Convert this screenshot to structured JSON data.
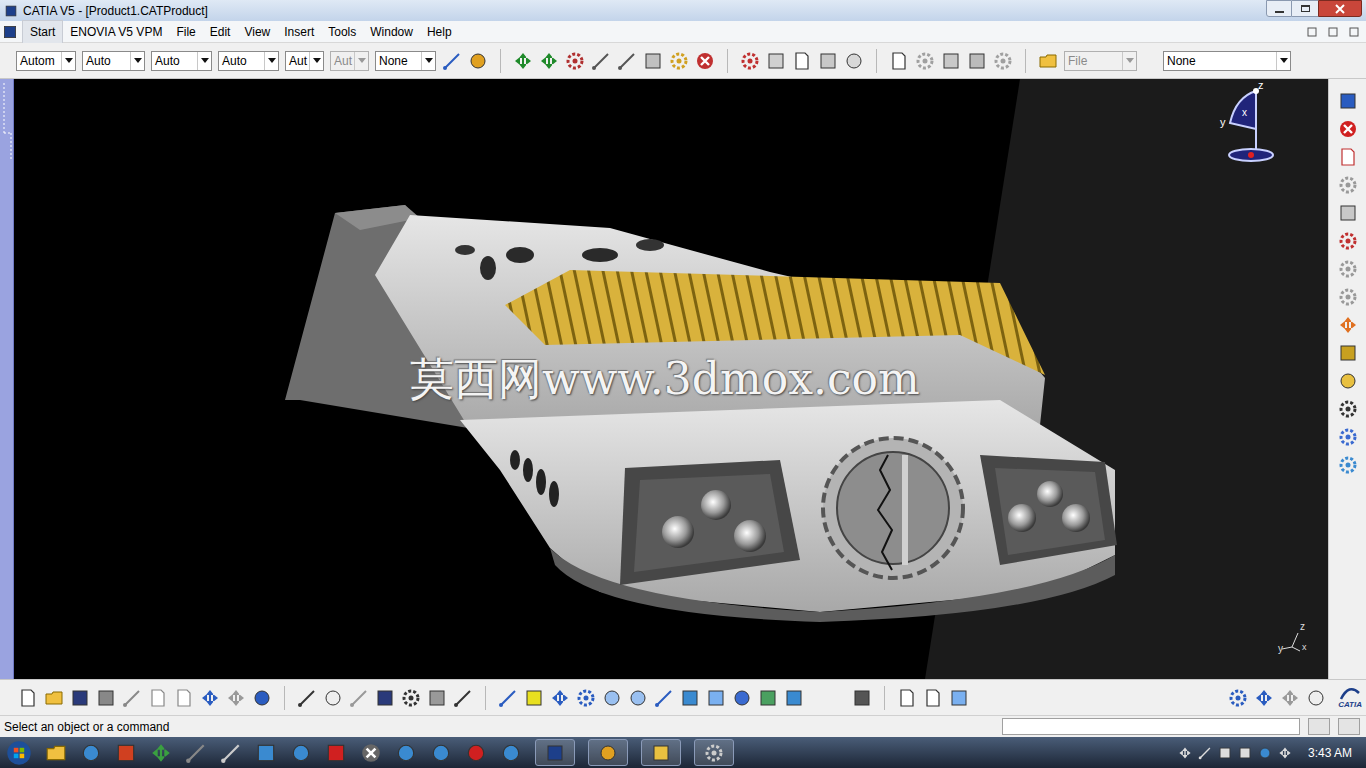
{
  "window": {
    "title": "CATIA V5 - [Product1.CATProduct]"
  },
  "menu": [
    "Start",
    "ENOVIA V5 VPM",
    "File",
    "Edit",
    "View",
    "Insert",
    "Tools",
    "Window",
    "Help"
  ],
  "toolbar_dropdowns": [
    {
      "label": "Autom",
      "disabled": false
    },
    {
      "label": "Auto",
      "disabled": false
    },
    {
      "label": "Auto",
      "disabled": false
    },
    {
      "label": "Auto",
      "disabled": false
    },
    {
      "label": "Aut",
      "disabled": false
    },
    {
      "label": "Aut",
      "disabled": true
    },
    {
      "label": "None",
      "disabled": false
    }
  ],
  "workbench_dropdowns": [
    {
      "label": "File",
      "disabled": true
    },
    {
      "label": "None",
      "disabled": false
    }
  ],
  "viewport": {
    "watermark": "莫西网www.3dmox.com",
    "compass": {
      "z": "z",
      "y": "y",
      "x": "x"
    },
    "axis": {
      "z": "z",
      "y": "y",
      "x": "x"
    }
  },
  "logo": "CATIA",
  "status_bar": {
    "prompt": "Select an object or a command"
  },
  "taskbar": {
    "clock": "3:43 AM"
  }
}
